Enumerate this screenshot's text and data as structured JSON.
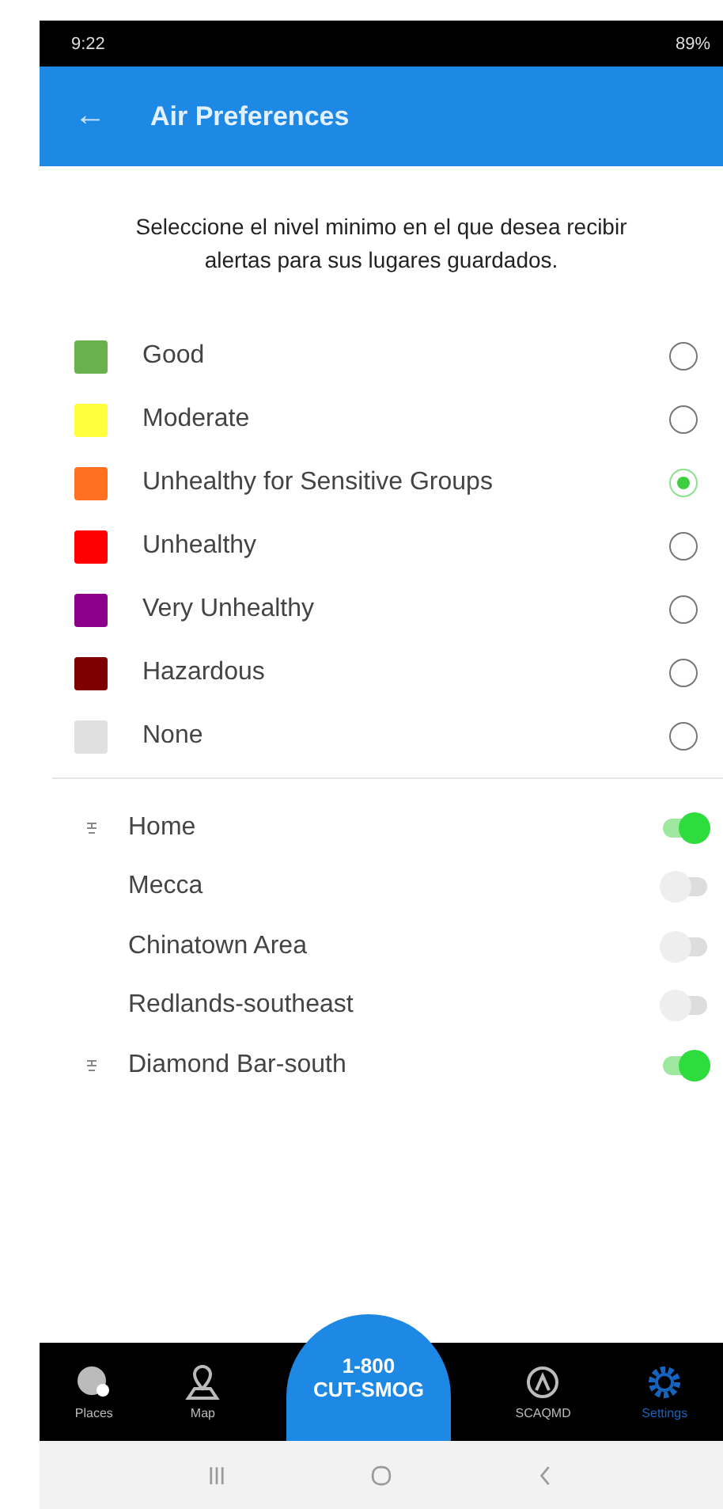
{
  "status_bar": {
    "time": "9:22",
    "battery": "89%"
  },
  "app_bar": {
    "back": "←",
    "title": "Air Preferences"
  },
  "intro": "Seleccione el nivel minimo en el que desea recibir alertas para sus lugares guardados.",
  "levels": [
    {
      "label": "Good",
      "color": "#6ab04c",
      "selected": false
    },
    {
      "label": "Moderate",
      "color": "#ffff3c",
      "selected": false
    },
    {
      "label": "Unhealthy for Sensitive Groups",
      "color": "#ff7020",
      "selected": true
    },
    {
      "label": "Unhealthy",
      "color": "#ff0000",
      "selected": false
    },
    {
      "label": "Very Unhealthy",
      "color": "#8b008b",
      "selected": false
    },
    {
      "label": "Hazardous",
      "color": "#7e0000",
      "selected": false
    },
    {
      "label": "None",
      "color": "#e0e0e0",
      "selected": false
    }
  ],
  "places": [
    {
      "name": "Home",
      "pinned": true,
      "on": true
    },
    {
      "name": "Mecca",
      "pinned": false,
      "on": false
    },
    {
      "name": "Chinatown Area",
      "pinned": false,
      "on": false
    },
    {
      "name": "Redlands-southeast",
      "pinned": false,
      "on": false
    },
    {
      "name": "Diamond Bar-south",
      "pinned": true,
      "on": true
    }
  ],
  "bottom_nav": {
    "items": [
      {
        "label": "Places",
        "kind": "globe",
        "selected": false
      },
      {
        "label": "Map",
        "kind": "map",
        "selected": false
      },
      {
        "label": "SCAQMD",
        "kind": "logo",
        "selected": false
      },
      {
        "label": "Settings",
        "kind": "gear",
        "selected": true
      }
    ],
    "call_button": [
      "1-800",
      "CUT-SMOG"
    ]
  }
}
